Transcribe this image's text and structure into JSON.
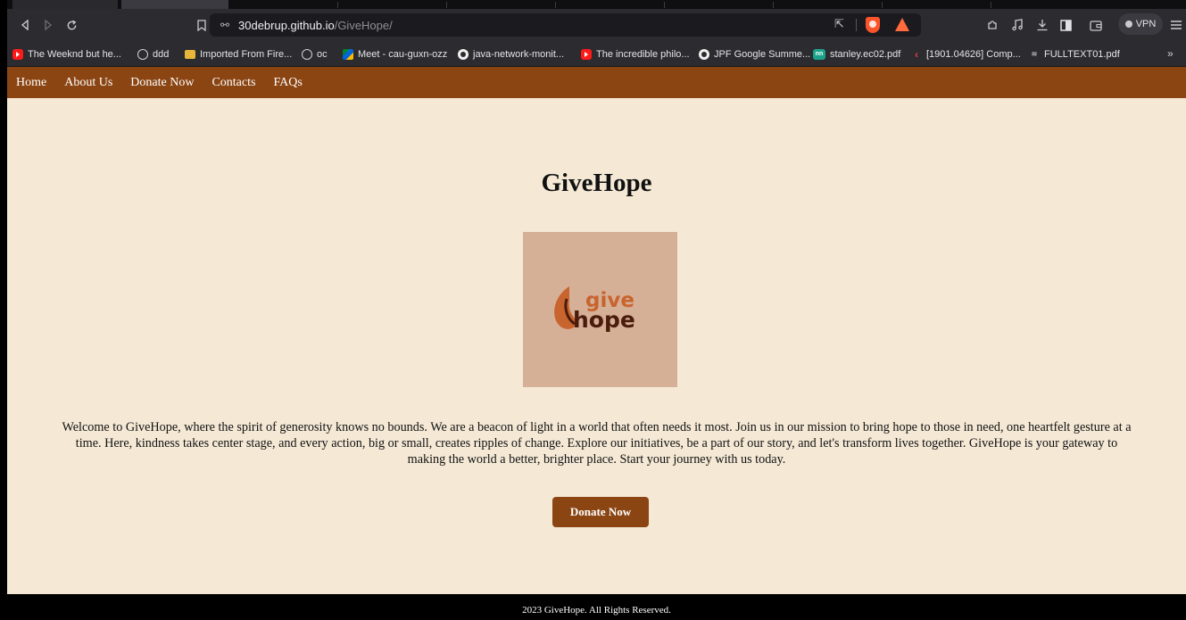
{
  "browser": {
    "url_host": "30debrup.github.io",
    "url_path": "/GiveHope/",
    "vpn_label": "VPN",
    "bookmarks": [
      {
        "label": "The Weeknd but he...",
        "icon": "youtube-icon"
      },
      {
        "label": "ddd",
        "icon": "globe-icon"
      },
      {
        "label": "Imported From Fire...",
        "icon": "folder-icon"
      },
      {
        "label": "oc",
        "icon": "globe-icon"
      },
      {
        "label": "Meet - cau-guxn-ozz",
        "icon": "google-meet-icon"
      },
      {
        "label": "java-network-monit...",
        "icon": "github-icon"
      },
      {
        "label": "The incredible philo...",
        "icon": "youtube-icon"
      },
      {
        "label": "JPF Google Summe...",
        "icon": "github-icon"
      },
      {
        "label": "stanley.ec02.pdf",
        "icon": "nn-icon"
      },
      {
        "label": "[1901.04626] Comp...",
        "icon": "arxiv-icon"
      },
      {
        "label": "FULLTEXT01.pdf",
        "icon": "pdf-icon"
      }
    ],
    "more_label": "»"
  },
  "nav": {
    "items": [
      "Home",
      "About Us",
      "Donate Now",
      "Contacts",
      "FAQs"
    ]
  },
  "main": {
    "title": "GiveHope",
    "logo_text_top": "give",
    "logo_text_bottom": "hope",
    "intro": "Welcome to GiveHope, where the spirit of generosity knows no bounds. We are a beacon of light in a world that often needs it most. Join us in our mission to bring hope to those in need, one heartfelt gesture at a time. Here, kindness takes center stage, and every action, big or small, creates ripples of change. Explore our initiatives, be a part of our story, and let's transform lives together. GiveHope is your gateway to making the world a better, brighter place. Start your journey with us today.",
    "donate_button": "Donate Now"
  },
  "footer": {
    "text": "2023 GiveHope. All Rights Reserved."
  },
  "colors": {
    "nav_bg": "#8b4513",
    "page_bg": "#f5e9d6",
    "logo_bg": "#d6af97",
    "logo_orange": "#c8642e",
    "logo_dark": "#4a1c0c"
  }
}
